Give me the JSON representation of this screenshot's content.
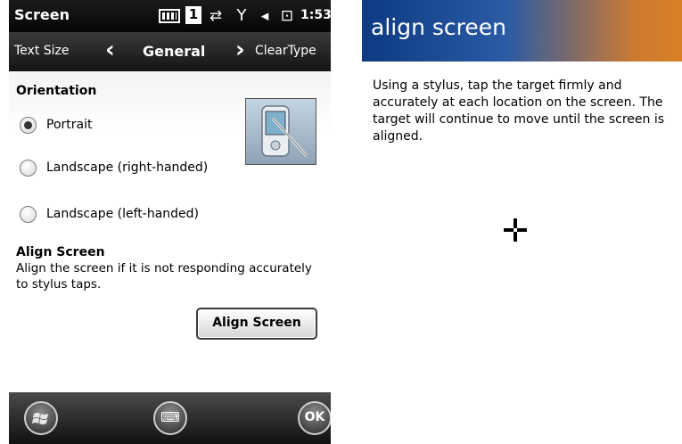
{
  "status_bar": {
    "title": "Screen",
    "sim_indicator": "1",
    "time": "1:53",
    "icons": [
      "battery-icon",
      "sim-icon",
      "sync-icon",
      "signal-icon",
      "volume-icon",
      "power-icon"
    ]
  },
  "nav_bar": {
    "prev": "Text Size",
    "current": "General",
    "next": "ClearType"
  },
  "orientation": {
    "heading": "Orientation",
    "options": [
      {
        "label": "Portrait",
        "checked": true
      },
      {
        "label": "Landscape (right-handed)",
        "checked": false
      },
      {
        "label": "Landscape (left-handed)",
        "checked": false
      }
    ]
  },
  "align_section": {
    "heading": "Align Screen",
    "description": "Align the screen if it is not responding accurately to stylus taps.",
    "button_label": "Align Screen"
  },
  "softkeys": {
    "start_icon": "windows-start-icon",
    "keyboard_icon": "keyboard-icon",
    "ok_label": "OK"
  },
  "align_screen_page": {
    "title": "align screen",
    "instructions": "Using a stylus, tap the target firmly and accurately at each location on the screen. The target will continue to move until the screen is aligned.",
    "target_icon": "crosshair-icon"
  },
  "colors": {
    "status_bar": "#0a0a0a",
    "header_gradient_start": "#0d3a82",
    "header_gradient_end": "#d98026"
  }
}
